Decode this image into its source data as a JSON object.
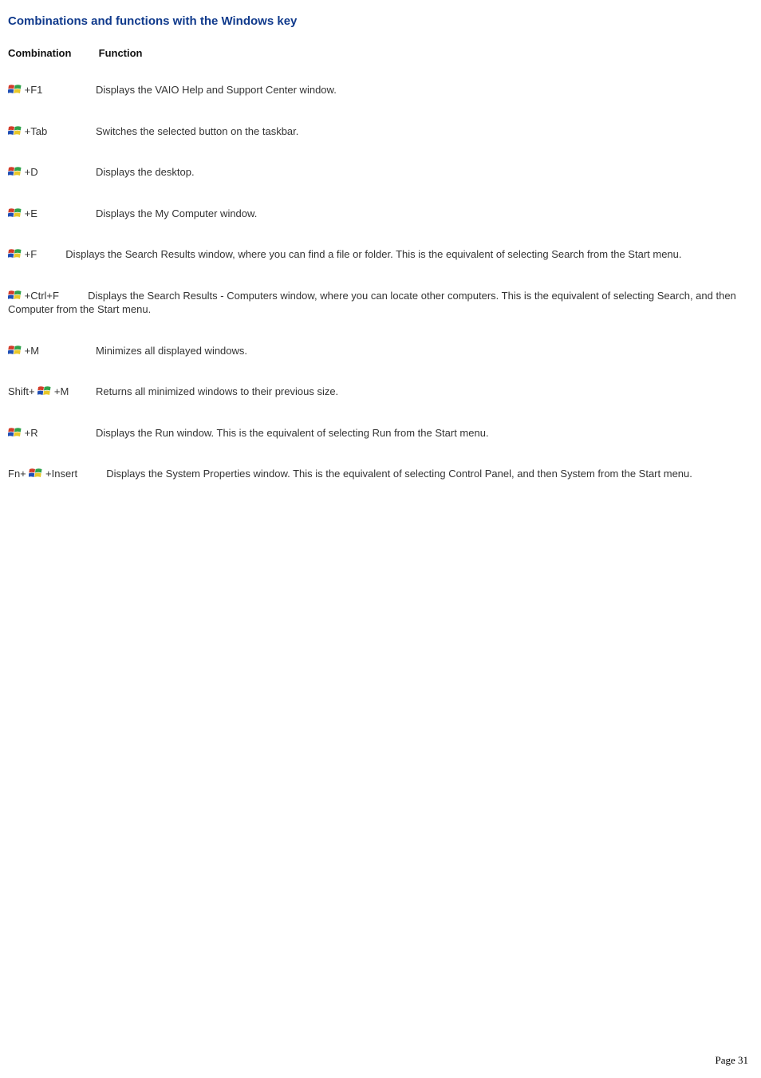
{
  "title": "Combinations and functions with the Windows key",
  "header_combo": "Combination",
  "header_func": "Function",
  "entries": [
    {
      "pre": "",
      "suffix": "+F1",
      "func": "Displays the VAIO Help and Support Center window.",
      "wrap": false
    },
    {
      "pre": "",
      "suffix": "+Tab",
      "func": "Switches the selected button on the taskbar.",
      "wrap": false
    },
    {
      "pre": "",
      "suffix": "+D",
      "func": "Displays the desktop.",
      "wrap": false
    },
    {
      "pre": "",
      "suffix": "+E",
      "func": "Displays the My Computer window.",
      "wrap": false
    },
    {
      "pre": "",
      "suffix": "+F",
      "func": "Displays the Search Results window, where you can find a file or folder. This is the equivalent of selecting Search from the Start menu.",
      "wrap": true
    },
    {
      "pre": "",
      "suffix": "+Ctrl+F",
      "func": "Displays the Search Results - Computers window, where you can locate other computers. This is the equivalent of selecting Search, and then Computer from the Start menu.",
      "wrap": true
    },
    {
      "pre": "",
      "suffix": "+M",
      "func": "Minimizes all displayed windows.",
      "wrap": false
    },
    {
      "pre": "Shift+",
      "suffix": " +M",
      "func": "Returns all minimized windows to their previous size.",
      "wrap": false
    },
    {
      "pre": "",
      "suffix": "+R",
      "func": "Displays the Run window. This is the equivalent of selecting Run from the Start menu.",
      "wrap": false
    },
    {
      "pre": "Fn+",
      "suffix": " +Insert",
      "func": "Displays the System Properties window. This is the equivalent of selecting Control Panel, and then System from the Start menu.",
      "wrap": true
    }
  ],
  "page_number": "Page 31"
}
